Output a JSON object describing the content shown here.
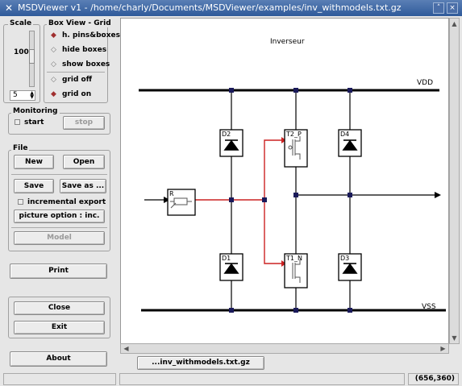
{
  "window": {
    "title": "MSDViewer v1 - /home/charly/Documents/MSDViewer/examples/inv_withmodels.txt.gz",
    "minimize_glyph": "˄",
    "close_glyph": "×"
  },
  "scale": {
    "label": "Scale",
    "value": "100",
    "spin_value": "5"
  },
  "box_view": {
    "label": "Box View - Grid",
    "options": [
      "h. pins&boxes",
      "hide boxes",
      "show boxes",
      "grid off",
      "grid on"
    ],
    "selected": [
      "h. pins&boxes",
      "grid on"
    ]
  },
  "monitoring": {
    "label": "Monitoring",
    "start_label": "start",
    "stop_label": "stop"
  },
  "file": {
    "label": "File",
    "new_label": "New",
    "open_label": "Open",
    "save_label": "Save",
    "save_as_label": "Save as ...",
    "incremental_label": "incremental export",
    "picture_option_label": "picture option : inc.",
    "model_label": "Model"
  },
  "actions": {
    "print_label": "Print",
    "close_label": "Close",
    "exit_label": "Exit",
    "about_label": "About"
  },
  "diagram": {
    "title": "Inverseur",
    "rail_top": "VDD",
    "rail_bottom": "VSS",
    "components": {
      "d2": "D2",
      "t2": "T2_P",
      "d4": "D4",
      "d1": "D1",
      "t1": "T1_N",
      "d3": "D3",
      "r": "R"
    },
    "colors": {
      "wire": "#000000",
      "signal": "#cc2222",
      "rail": "#000000",
      "node": "#1a1a5a"
    }
  },
  "tab": {
    "label": "...inv_withmodels.txt.gz"
  },
  "status": {
    "coords": "(656,360)"
  }
}
